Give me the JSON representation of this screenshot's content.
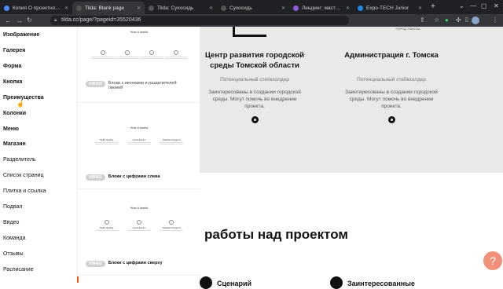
{
  "browser": {
    "tabs": [
      {
        "label": "Копия О проектной карте",
        "fav": "#4c8bf5",
        "active": false
      },
      {
        "label": "Tilda: Blank page",
        "fav": "#555555",
        "active": true
      },
      {
        "label": "Tilda: Сухосидь",
        "fav": "#555555",
        "active": false
      },
      {
        "label": "Сухосидь",
        "fav": "#555555",
        "active": false
      },
      {
        "label": "Лендинг: мастер-класс",
        "fav": "#8e5cd9",
        "active": false
      },
      {
        "label": "Expo-TECH Junior",
        "fav": "#1e88e5",
        "active": false
      }
    ],
    "new_tab": "+",
    "url": "tilda.cc/page/?pageid=35520436"
  },
  "categories": [
    {
      "label": "Изображение",
      "bold": true
    },
    {
      "label": "Галерея",
      "bold": true
    },
    {
      "label": "Форма",
      "bold": true
    },
    {
      "label": "Кнопка",
      "bold": true
    },
    {
      "label": "Преимущества",
      "bold": true
    },
    {
      "label": "Колонки",
      "bold": true
    },
    {
      "label": "Меню",
      "bold": true
    },
    {
      "label": "Магазин",
      "bold": true
    },
    {
      "label": "Разделитель",
      "bold": false
    },
    {
      "label": "Список страниц",
      "bold": false
    },
    {
      "label": "Плитка и ссылка",
      "bold": false
    },
    {
      "label": "Подвал",
      "bold": false
    },
    {
      "label": "Видео",
      "bold": false
    },
    {
      "label": "Команда",
      "bold": false
    },
    {
      "label": "Отзывы",
      "bold": false
    },
    {
      "label": "Расписание",
      "bold": false
    }
  ],
  "blocks": [
    {
      "thumb_title": "How it works",
      "thumb_items": [
        "",
        "",
        "",
        ""
      ],
      "badge": "HW303",
      "name": "Блоки с иконками и разделителей",
      "name_extra": "линией"
    },
    {
      "thumb_title": "How it works",
      "thumb_items": [
        "Night Quality",
        "Good Expert",
        "Satisfied Support"
      ],
      "badge": "HW401",
      "name": "Блоки с цифрами слева",
      "name_extra": ""
    },
    {
      "thumb_title": "How it works",
      "thumb_items": [
        "Night Quality",
        "Good Expert",
        "Satisfied Support"
      ],
      "badge": "HW402",
      "name": "Блоки с цифрами сверху",
      "name_extra": ""
    }
  ],
  "preview": {
    "logo_subtitle": "ГОРОД ТОМСКА",
    "cards": [
      {
        "title": "Центр развития городской среды Томской области",
        "role": "Потенциальный стейкхолдер",
        "desc": "Заинтересованы в создании городской среды. Могут помочь во внедрении проекта."
      },
      {
        "title": "Администрация г. Томска",
        "role": "Потенциальный стейкхолдер",
        "desc": "Заинтересованы в создании городской среды. Могут помочь во внедрении проекта."
      }
    ],
    "heading": "работы над проектом",
    "bottom_items": [
      "Сценарий",
      "Заинтересованные"
    ],
    "help_label": "?"
  }
}
